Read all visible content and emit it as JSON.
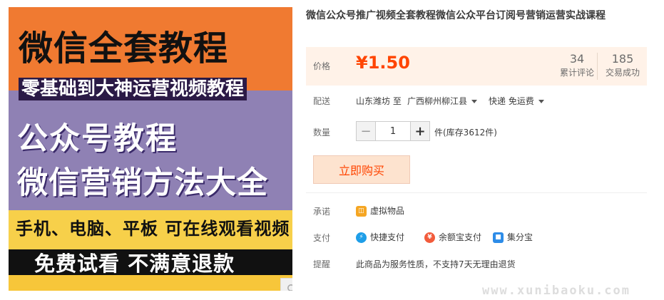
{
  "banner": {
    "line1": "微信全套教程",
    "line2": "零基础到大神运营视频教程",
    "line3": "公众号教程",
    "line4": "微信营销方法大全",
    "line5": "手机、电脑、平板 可在线观看视频",
    "line6": "免费试看 不满意退款"
  },
  "product": {
    "title": "微信公众号推广视频全套教程微信公众平台订阅号营销运营实战课程"
  },
  "price": {
    "label": "价格",
    "value": "¥1.50",
    "reviews_count": "34",
    "reviews_label": "累计评论",
    "sales_count": "185",
    "sales_label": "交易成功"
  },
  "delivery": {
    "label": "配送",
    "from": "山东潍坊 至",
    "to": "广西柳州柳江县",
    "method": "快递 免运费"
  },
  "quantity": {
    "label": "数量",
    "minus": "−",
    "value": "1",
    "plus": "+",
    "stock": "件(库存3612件)"
  },
  "buy_button": "立即购买",
  "promise": {
    "label": "承诺",
    "item": "虚拟物品"
  },
  "payment": {
    "label": "支付",
    "methods": [
      "快捷支付",
      "余额宝支付",
      "集分宝"
    ]
  },
  "reminder": {
    "label": "提醒",
    "text": "此商品为服务性质，不支持7天无理由退货"
  },
  "watermark": "www.xunibaoku.com",
  "colors": {
    "price": "#ff4400",
    "price_bg": "#fff2e8",
    "buy_bg": "#fde3cf"
  }
}
